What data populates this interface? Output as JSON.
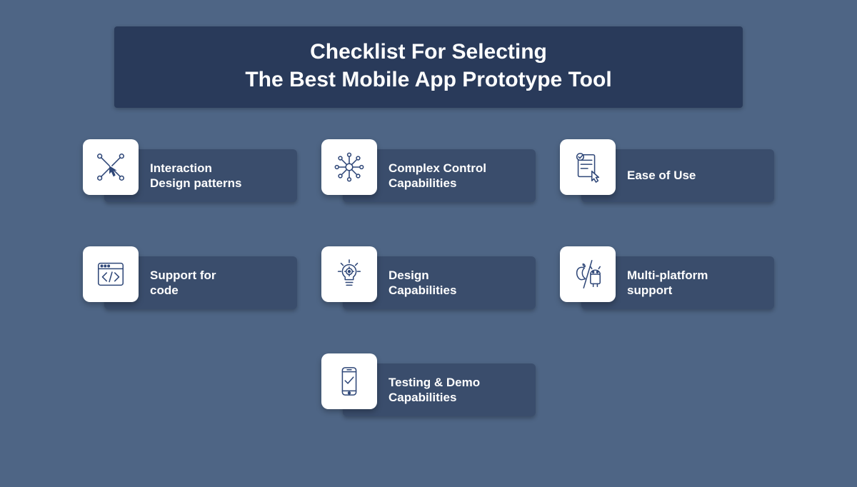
{
  "header": {
    "line1": "Checklist For Selecting",
    "line2": "The Best Mobile App Prototype Tool"
  },
  "cards": [
    {
      "icon": "network-touch",
      "label": "Interaction\nDesign patterns"
    },
    {
      "icon": "network-hub",
      "label": "Complex Control\nCapabilities"
    },
    {
      "icon": "ease-check",
      "label": "Ease of Use"
    },
    {
      "icon": "code-window",
      "label": "Support for\ncode"
    },
    {
      "icon": "idea-bulb",
      "label": "Design\nCapabilities"
    },
    {
      "icon": "multi-platform",
      "label": "Multi-platform\nsupport"
    },
    {
      "icon": "phone-test",
      "label": "Testing & Demo\nCapabilities"
    }
  ]
}
